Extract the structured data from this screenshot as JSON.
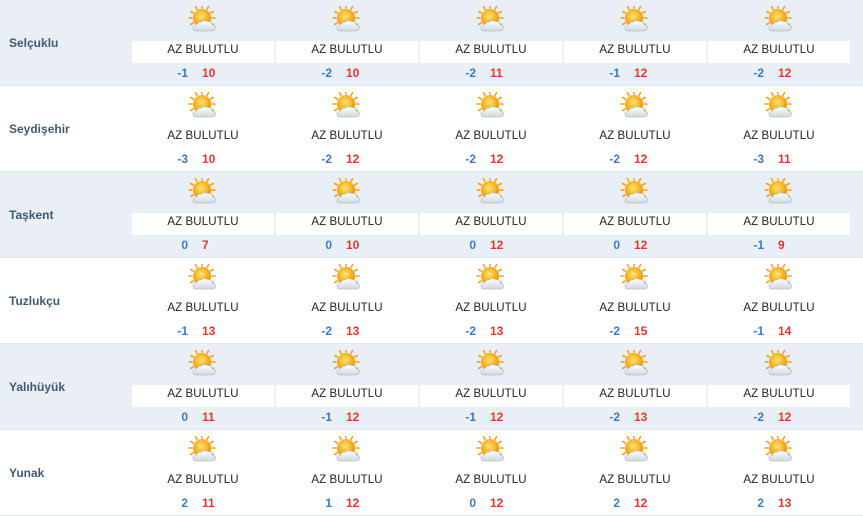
{
  "condition_label": "AZ BULUTLU",
  "icon": "partly-cloudy-sun-icon",
  "colors": {
    "min_temp": "#3a7ac4",
    "max_temp": "#d93a2f",
    "city_name": "#3f5a73",
    "row_band": "#e9eff4"
  },
  "rows": [
    {
      "city": "Selçuklu",
      "days": [
        {
          "condition": "AZ BULUTLU",
          "min": "-1",
          "max": "10"
        },
        {
          "condition": "AZ BULUTLU",
          "min": "-2",
          "max": "10"
        },
        {
          "condition": "AZ BULUTLU",
          "min": "-2",
          "max": "11"
        },
        {
          "condition": "AZ BULUTLU",
          "min": "-1",
          "max": "12"
        },
        {
          "condition": "AZ BULUTLU",
          "min": "-2",
          "max": "12"
        }
      ]
    },
    {
      "city": "Seydişehir",
      "days": [
        {
          "condition": "AZ BULUTLU",
          "min": "-3",
          "max": "10"
        },
        {
          "condition": "AZ BULUTLU",
          "min": "-2",
          "max": "12"
        },
        {
          "condition": "AZ BULUTLU",
          "min": "-2",
          "max": "12"
        },
        {
          "condition": "AZ BULUTLU",
          "min": "-2",
          "max": "12"
        },
        {
          "condition": "AZ BULUTLU",
          "min": "-3",
          "max": "11"
        }
      ]
    },
    {
      "city": "Taşkent",
      "days": [
        {
          "condition": "AZ BULUTLU",
          "min": "0",
          "max": "7"
        },
        {
          "condition": "AZ BULUTLU",
          "min": "0",
          "max": "10"
        },
        {
          "condition": "AZ BULUTLU",
          "min": "0",
          "max": "12"
        },
        {
          "condition": "AZ BULUTLU",
          "min": "0",
          "max": "12"
        },
        {
          "condition": "AZ BULUTLU",
          "min": "-1",
          "max": "9"
        }
      ]
    },
    {
      "city": "Tuzlukçu",
      "days": [
        {
          "condition": "AZ BULUTLU",
          "min": "-1",
          "max": "13"
        },
        {
          "condition": "AZ BULUTLU",
          "min": "-2",
          "max": "13"
        },
        {
          "condition": "AZ BULUTLU",
          "min": "-2",
          "max": "13"
        },
        {
          "condition": "AZ BULUTLU",
          "min": "-2",
          "max": "15"
        },
        {
          "condition": "AZ BULUTLU",
          "min": "-1",
          "max": "14"
        }
      ]
    },
    {
      "city": "Yalıhüyük",
      "days": [
        {
          "condition": "AZ BULUTLU",
          "min": "0",
          "max": "11"
        },
        {
          "condition": "AZ BULUTLU",
          "min": "-1",
          "max": "12"
        },
        {
          "condition": "AZ BULUTLU",
          "min": "-1",
          "max": "12"
        },
        {
          "condition": "AZ BULUTLU",
          "min": "-2",
          "max": "13"
        },
        {
          "condition": "AZ BULUTLU",
          "min": "-2",
          "max": "12"
        }
      ]
    },
    {
      "city": "Yunak",
      "days": [
        {
          "condition": "AZ BULUTLU",
          "min": "2",
          "max": "11"
        },
        {
          "condition": "AZ BULUTLU",
          "min": "1",
          "max": "12"
        },
        {
          "condition": "AZ BULUTLU",
          "min": "0",
          "max": "12"
        },
        {
          "condition": "AZ BULUTLU",
          "min": "2",
          "max": "12"
        },
        {
          "condition": "AZ BULUTLU",
          "min": "2",
          "max": "13"
        }
      ]
    }
  ]
}
